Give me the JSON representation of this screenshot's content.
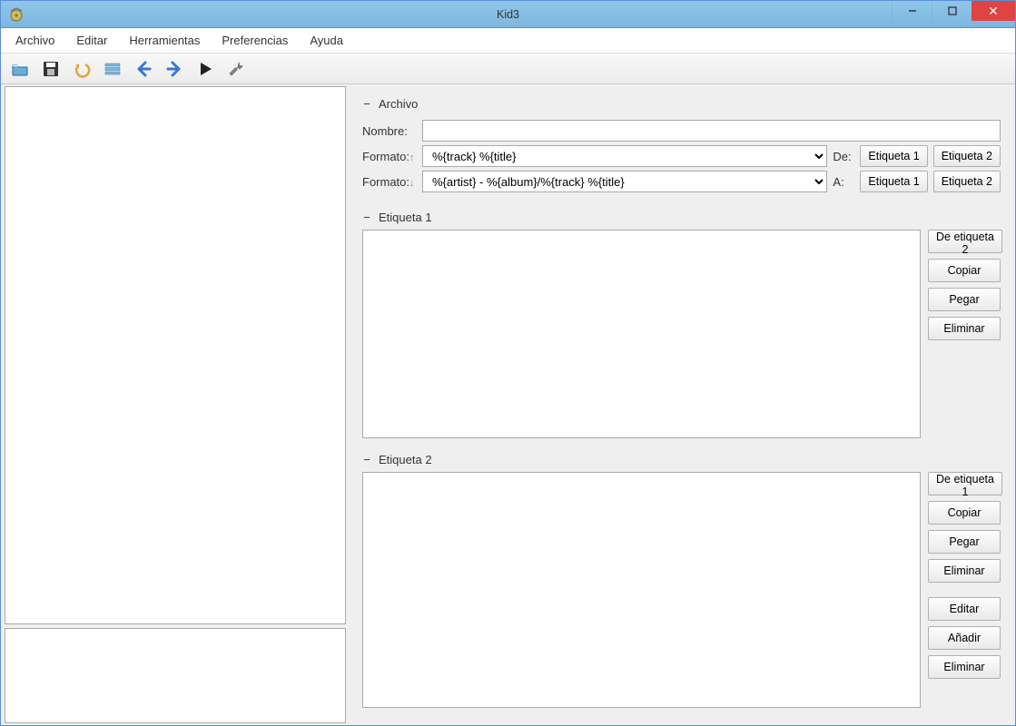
{
  "app": {
    "title": "Kid3"
  },
  "menu": {
    "file": "Archivo",
    "edit": "Editar",
    "tools": "Herramientas",
    "preferences": "Preferencias",
    "help": "Ayuda"
  },
  "sections": {
    "archivo": {
      "title": "Archivo",
      "nombre_label": "Nombre:",
      "formato_up_label": "Formato:",
      "formato_down_label": "Formato:",
      "formato_up_value": "%{track} %{title}",
      "formato_down_value": "%{artist} - %{album}/%{track} %{title}",
      "from_label": "De:",
      "to_label": "A:",
      "etiqueta1_btn": "Etiqueta 1",
      "etiqueta2_btn": "Etiqueta 2",
      "nombre_value": ""
    },
    "etiqueta1": {
      "title": "Etiqueta 1",
      "from_tag2": "De etiqueta 2",
      "copy": "Copiar",
      "paste": "Pegar",
      "delete": "Eliminar"
    },
    "etiqueta2": {
      "title": "Etiqueta 2",
      "from_tag1": "De etiqueta 1",
      "copy": "Copiar",
      "paste": "Pegar",
      "delete": "Eliminar",
      "edit": "Editar",
      "add": "Añadir",
      "delete2": "Eliminar"
    }
  }
}
